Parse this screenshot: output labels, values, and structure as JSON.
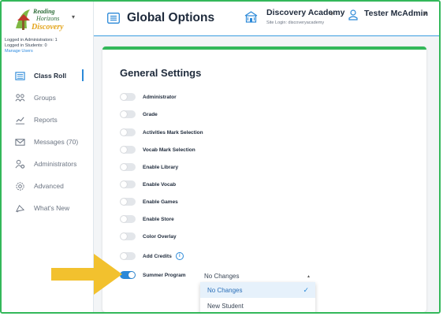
{
  "brand": {
    "logo_line1": "Reading",
    "logo_line2": "Horizons",
    "logo_line3": "Discovery"
  },
  "login_info": {
    "admins": "Logged in Administrators: 1",
    "students": "Logged in Students: 0",
    "manage_link": "Manage Users"
  },
  "nav": [
    {
      "label": "Class Roll",
      "icon": "roster-icon",
      "active": true
    },
    {
      "label": "Groups",
      "icon": "groups-icon"
    },
    {
      "label": "Reports",
      "icon": "reports-icon"
    },
    {
      "label": "Messages (70)",
      "icon": "mail-icon"
    },
    {
      "label": "Administrators",
      "icon": "admin-gear-icon"
    },
    {
      "label": "Advanced",
      "icon": "gear-icon"
    },
    {
      "label": "What's New",
      "icon": "megaphone-icon"
    }
  ],
  "header": {
    "title": "Global Options",
    "school_name": "Discovery Academy",
    "site_login": "Site Login: discoveryacademy",
    "user_name": "Tester McAdmin"
  },
  "card": {
    "title": "General Settings"
  },
  "settings": [
    {
      "label": "Administrator",
      "on": false
    },
    {
      "label": "Grade",
      "on": false
    },
    {
      "label": "Activities Mark Selection",
      "on": false
    },
    {
      "label": "Vocab Mark Selection",
      "on": false
    },
    {
      "label": "Enable Library",
      "on": false
    },
    {
      "label": "Enable Vocab",
      "on": false
    },
    {
      "label": "Enable Games",
      "on": false
    },
    {
      "label": "Enable Store",
      "on": false
    },
    {
      "label": "Color Overlay",
      "on": false
    },
    {
      "label": "Add Credits",
      "on": false,
      "info": true
    },
    {
      "label": "Summer Program",
      "on": true
    }
  ],
  "summer_select": {
    "value": "No Changes",
    "options": [
      "No Changes",
      "New Student"
    ],
    "selected_index": 0
  },
  "colors": {
    "accent_green": "#33b85a",
    "accent_blue": "#2b89d8",
    "arrow_yellow": "#f2c12e"
  }
}
